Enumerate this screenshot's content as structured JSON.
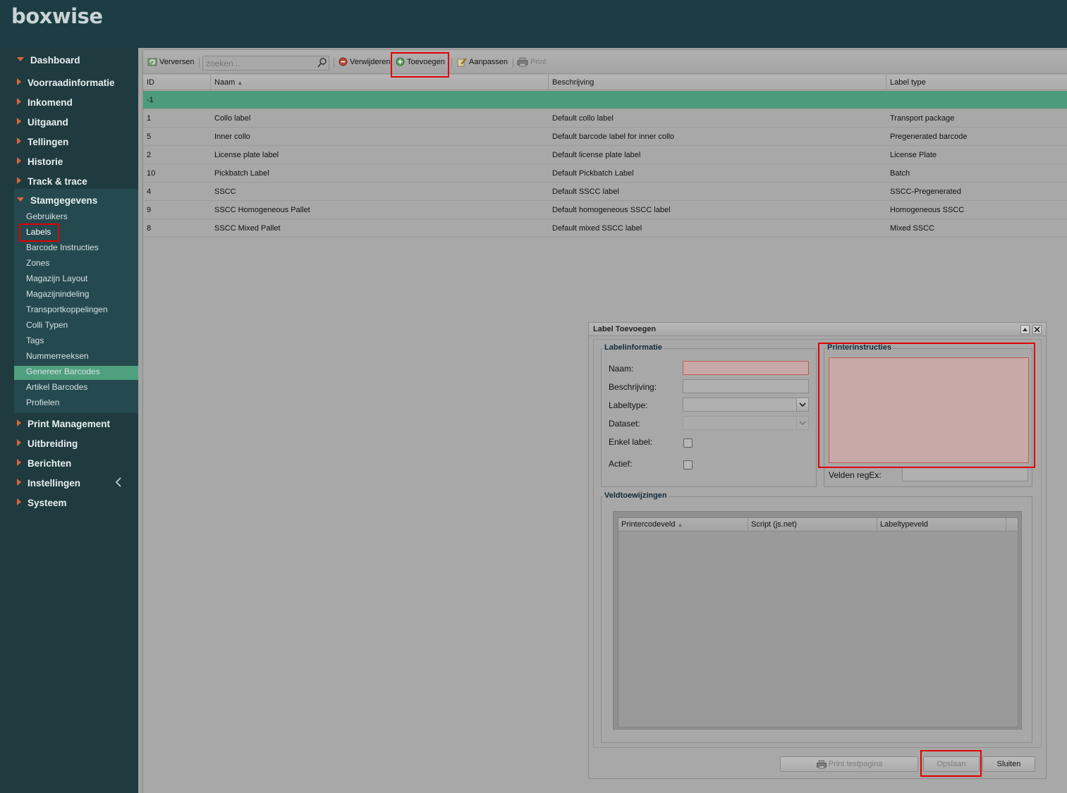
{
  "app": {
    "logo": "boxwise"
  },
  "sidebar": {
    "items": [
      {
        "label": "Dashboard",
        "expanded": true
      },
      {
        "label": "Voorraadinformatie"
      },
      {
        "label": "Inkomend"
      },
      {
        "label": "Uitgaand"
      },
      {
        "label": "Tellingen"
      },
      {
        "label": "Historie"
      },
      {
        "label": "Track & trace"
      },
      {
        "label": "Stamgegevens",
        "expanded": true
      },
      {
        "label": "Print Management"
      },
      {
        "label": "Uitbreiding"
      },
      {
        "label": "Berichten"
      },
      {
        "label": "Instellingen"
      },
      {
        "label": "Systeem"
      }
    ],
    "submenu": [
      "Gebruikers",
      "Labels",
      "Barcode Instructies",
      "Zones",
      "Magazijn Layout",
      "Magazijnindeling",
      "Transportkoppelingen",
      "Colli Typen",
      "Tags",
      "Nummerreeksen",
      "Genereer Barcodes",
      "Artikel Barcodes",
      "Profielen"
    ],
    "active_submenu": "Labels"
  },
  "toolbar": {
    "refresh": "Verversen",
    "search_placeholder": "zoeken...",
    "delete": "Verwijderen",
    "add": "Toevoegen",
    "edit": "Aanpassen",
    "print": "Print"
  },
  "grid": {
    "columns": [
      "ID",
      "Naam",
      "Beschrijving",
      "Label type"
    ],
    "sorted_column": "Naam",
    "selected_row": {
      "id": "-1",
      "name": "",
      "description": "",
      "type": ""
    },
    "rows": [
      {
        "id": "1",
        "name": "Collo label",
        "description": "Default collo label",
        "type": "Transport package"
      },
      {
        "id": "5",
        "name": "Inner collo",
        "description": "Default barcode label for inner collo",
        "type": "Pregenerated barcode"
      },
      {
        "id": "2",
        "name": "License plate label",
        "description": "Default license plate label",
        "type": "License Plate"
      },
      {
        "id": "10",
        "name": "Pickbatch Label",
        "description": "Default Pickbatch Label",
        "type": "Batch"
      },
      {
        "id": "4",
        "name": "SSCC",
        "description": "Default SSCC label",
        "type": "SSCC-Pregenerated"
      },
      {
        "id": "9",
        "name": "SSCC Homogeneous Pallet",
        "description": "Default homogeneous SSCC label",
        "type": "Homogeneous SSCC"
      },
      {
        "id": "8",
        "name": "SSCC Mixed Pallet",
        "description": "Default mixed SSCC label",
        "type": "Mixed SSCC"
      }
    ]
  },
  "dialog": {
    "title": "Label Toevoegen",
    "labelinfo": {
      "legend": "Labelinformatie",
      "name_label": "Naam:",
      "name_value": "",
      "description_label": "Beschrijving:",
      "description_value": "",
      "labeltype_label": "Labeltype:",
      "labeltype_value": "",
      "dataset_label": "Dataset:",
      "dataset_value": "",
      "single_label": "Enkel label:",
      "single_checked": false,
      "active_label": "Actief:",
      "active_checked": false
    },
    "printer": {
      "legend": "Printerinstructies",
      "instructions_value": "",
      "regex_label": "Velden regEx:",
      "regex_value": ""
    },
    "assignments": {
      "legend": "Veldtoewijzingen",
      "columns": [
        "Printercodeveld",
        "Script (js.net)",
        "Labeltypeveld"
      ]
    },
    "buttons": {
      "print_test": "Print testpagina",
      "save": "Opslaan",
      "close": "Sluiten"
    }
  },
  "colors": {
    "sidebar_bg": "#1f3b40",
    "accent_arrow": "#d9663a",
    "active_green": "#4fa07f",
    "highlight_red": "#e00000"
  }
}
